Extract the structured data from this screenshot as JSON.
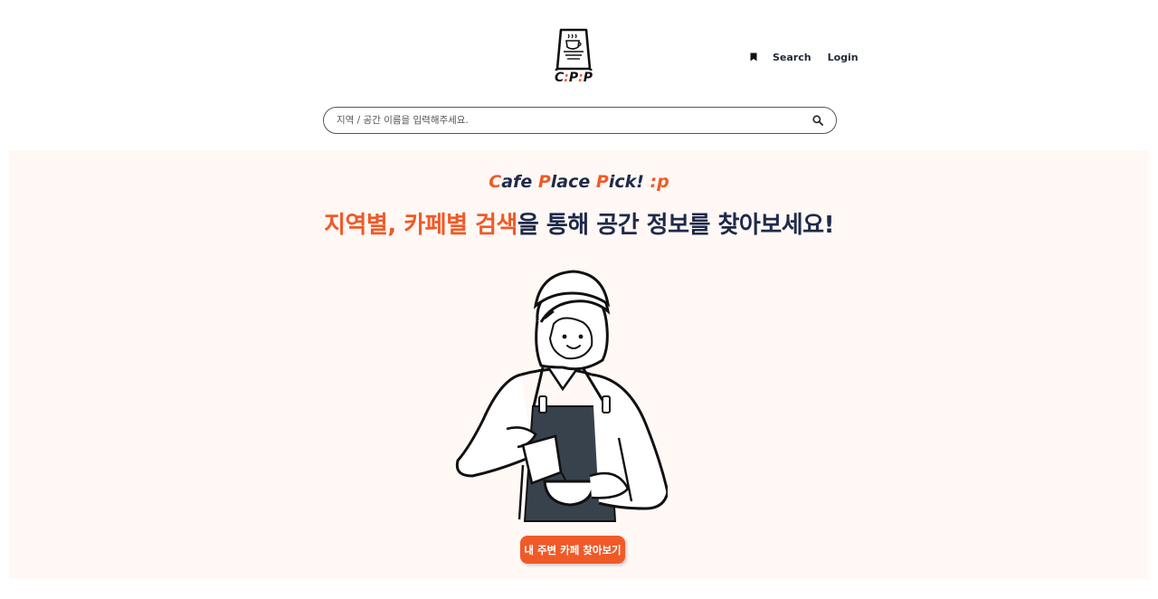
{
  "brand": {
    "logo_letters": [
      "C",
      ":",
      "P",
      ":",
      "P"
    ],
    "logo_alt": "C:P:P"
  },
  "nav": {
    "search_label": "Search",
    "login_label": "Login"
  },
  "search": {
    "placeholder": "지역 / 공간 이름을 입력해주세요."
  },
  "hero": {
    "tagline": {
      "c": "C",
      "afe": "afe ",
      "p1": "P",
      "lace": "lace ",
      "p2": "P",
      "ick": "ick! ",
      "p3": ":p"
    },
    "headline_highlight": "지역별, 카페별 검색",
    "headline_rest": "을 통해 공간 정보를 찾아보세요!",
    "cta_label": "내 주변 카페 찾아보기"
  },
  "colors": {
    "accent": "#f05a28",
    "navy": "#1e2a4a",
    "hero_bg": "#fff8f5",
    "apron": "#37424d"
  },
  "icons": [
    "cafe-sign-logo-icon",
    "bookmark-icon",
    "search-icon"
  ]
}
